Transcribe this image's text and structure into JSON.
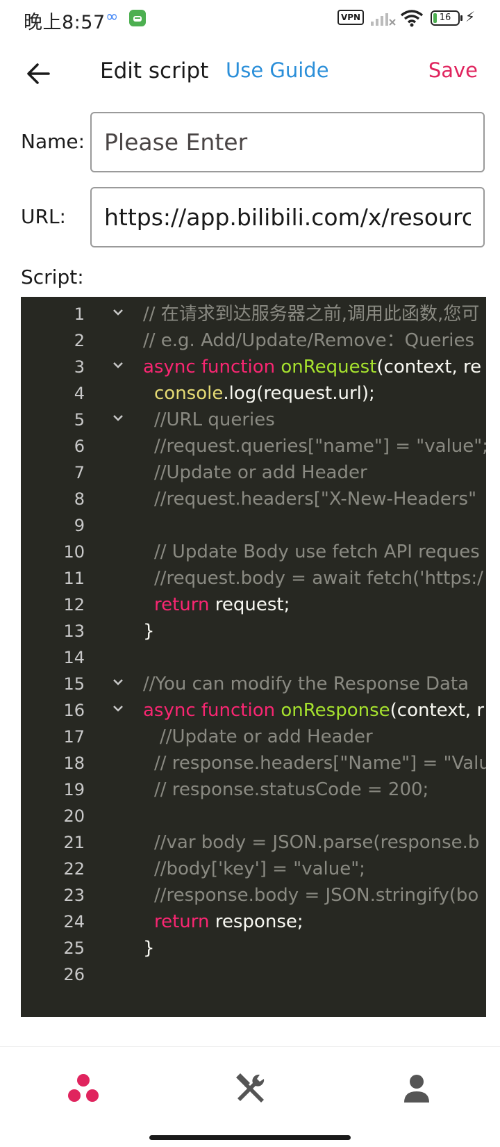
{
  "status_bar": {
    "time": "晚上8:57",
    "vpn_label": "VPN",
    "battery_level": "16",
    "battery_fraction": 0.16
  },
  "header": {
    "title": "Edit script",
    "guide_link": "Use Guide",
    "save_label": "Save"
  },
  "form": {
    "name_label": "Name:",
    "name_placeholder": "Please Enter",
    "name_value": "",
    "url_label": "URL:",
    "url_value": "https://app.bilibili.com/x/resourc",
    "script_label": "Script:"
  },
  "editor": {
    "lines": [
      {
        "n": "1",
        "fold": true,
        "indent": 0,
        "tokens": [
          {
            "t": "c",
            "v": "// 在请求到达服务器之前,调用此函数,您可"
          }
        ]
      },
      {
        "n": "2",
        "fold": false,
        "indent": 0,
        "tokens": [
          {
            "t": "c",
            "v": "// e.g. Add/Update/Remove：Queries"
          }
        ]
      },
      {
        "n": "3",
        "fold": true,
        "indent": 0,
        "tokens": [
          {
            "t": "k",
            "v": "async function "
          },
          {
            "t": "f",
            "v": "onRequest"
          },
          {
            "t": "p",
            "v": "(context, re"
          }
        ]
      },
      {
        "n": "4",
        "fold": false,
        "indent": 1,
        "tokens": [
          {
            "t": "b",
            "v": "console"
          },
          {
            "t": "p",
            "v": ".log(request.url);"
          }
        ]
      },
      {
        "n": "5",
        "fold": true,
        "indent": 1,
        "tokens": [
          {
            "t": "c",
            "v": "//URL queries"
          }
        ]
      },
      {
        "n": "6",
        "fold": false,
        "indent": 1,
        "tokens": [
          {
            "t": "c",
            "v": "//request.queries[\"name\"] = \"value\";"
          }
        ]
      },
      {
        "n": "7",
        "fold": false,
        "indent": 1,
        "tokens": [
          {
            "t": "c",
            "v": "//Update or add Header"
          }
        ]
      },
      {
        "n": "8",
        "fold": false,
        "indent": 1,
        "tokens": [
          {
            "t": "c",
            "v": "//request.headers[\"X-New-Headers\""
          }
        ]
      },
      {
        "n": "9",
        "fold": false,
        "indent": 0,
        "tokens": []
      },
      {
        "n": "10",
        "fold": false,
        "indent": 1,
        "tokens": [
          {
            "t": "c",
            "v": "// Update Body use fetch API reques"
          }
        ]
      },
      {
        "n": "11",
        "fold": false,
        "indent": 1,
        "tokens": [
          {
            "t": "c",
            "v": "//request.body = await fetch('https:/"
          }
        ]
      },
      {
        "n": "12",
        "fold": false,
        "indent": 1,
        "tokens": [
          {
            "t": "k",
            "v": "return "
          },
          {
            "t": "p",
            "v": "request;"
          }
        ]
      },
      {
        "n": "13",
        "fold": false,
        "indent": 0,
        "tokens": [
          {
            "t": "p",
            "v": "}"
          }
        ]
      },
      {
        "n": "14",
        "fold": false,
        "indent": 0,
        "tokens": []
      },
      {
        "n": "15",
        "fold": true,
        "indent": 0,
        "tokens": [
          {
            "t": "c",
            "v": "//You can modify the Response Data"
          }
        ]
      },
      {
        "n": "16",
        "fold": true,
        "indent": 0,
        "tokens": [
          {
            "t": "k",
            "v": "async function "
          },
          {
            "t": "f",
            "v": "onResponse"
          },
          {
            "t": "p",
            "v": "(context, r"
          }
        ]
      },
      {
        "n": "17",
        "fold": false,
        "indent": 2,
        "tokens": [
          {
            "t": "c",
            "v": "//Update or add Header"
          }
        ]
      },
      {
        "n": "18",
        "fold": false,
        "indent": 1,
        "tokens": [
          {
            "t": "c",
            "v": "// response.headers[\"Name\"] = \"Valu"
          }
        ]
      },
      {
        "n": "19",
        "fold": false,
        "indent": 1,
        "tokens": [
          {
            "t": "c",
            "v": "// response.statusCode = 200;"
          }
        ]
      },
      {
        "n": "20",
        "fold": false,
        "indent": 0,
        "tokens": []
      },
      {
        "n": "21",
        "fold": false,
        "indent": 1,
        "tokens": [
          {
            "t": "c",
            "v": "//var body = JSON.parse(response.b"
          }
        ]
      },
      {
        "n": "22",
        "fold": false,
        "indent": 1,
        "tokens": [
          {
            "t": "c",
            "v": "//body['key'] = \"value\";"
          }
        ]
      },
      {
        "n": "23",
        "fold": false,
        "indent": 1,
        "tokens": [
          {
            "t": "c",
            "v": "//response.body = JSON.stringify(bo"
          }
        ]
      },
      {
        "n": "24",
        "fold": false,
        "indent": 1,
        "tokens": [
          {
            "t": "k",
            "v": "return "
          },
          {
            "t": "p",
            "v": "response;"
          }
        ]
      },
      {
        "n": "25",
        "fold": false,
        "indent": 0,
        "tokens": [
          {
            "t": "p",
            "v": "}"
          }
        ]
      },
      {
        "n": "26",
        "fold": false,
        "indent": 0,
        "tokens": []
      }
    ]
  },
  "nav": {
    "items": [
      {
        "name": "home",
        "icon": "dots-icon",
        "active": true
      },
      {
        "name": "tools",
        "icon": "tools-icon",
        "active": false
      },
      {
        "name": "profile",
        "icon": "person-icon",
        "active": false
      }
    ]
  },
  "colors": {
    "accent": "#e0245e",
    "link": "#2b8fd9",
    "editor_bg": "#272822",
    "keyword": "#f92672",
    "function": "#a6e22e",
    "builtin": "#e6db74",
    "comment": "#8a8a82",
    "nav_inactive": "#555555"
  }
}
